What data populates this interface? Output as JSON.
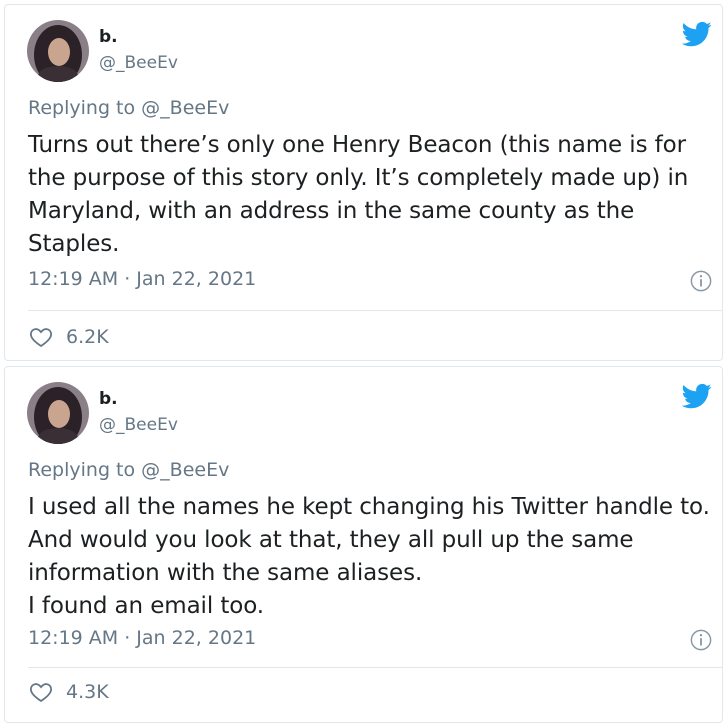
{
  "tweets": [
    {
      "author_name": "b.",
      "author_handle": "@_BeeEv",
      "replying_to": "Replying to @_BeeEv",
      "text": "Turns out there’s only one Henry Beacon (this name is for the purpose of this story only. It’s completely made up) in Maryland, with an address in the same county as the Staples.",
      "timestamp": "12:19 AM · Jan 22, 2021",
      "likes": "6.2K"
    },
    {
      "author_name": "b.",
      "author_handle": "@_BeeEv",
      "replying_to": "Replying to @_BeeEv",
      "text_lines": [
        "I used all the names he kept changing his Twitter handle to. And would you look at that, they all pull up the same information with the same aliases.",
        "I found an email too."
      ],
      "timestamp": "12:19 AM · Jan 22, 2021",
      "likes": "4.3K"
    }
  ],
  "colors": {
    "twitter_blue": "#1da1f2",
    "muted_text": "#657786",
    "border": "#e1e8ed"
  },
  "icons": [
    "twitter-bird-icon",
    "info-icon",
    "heart-icon"
  ]
}
